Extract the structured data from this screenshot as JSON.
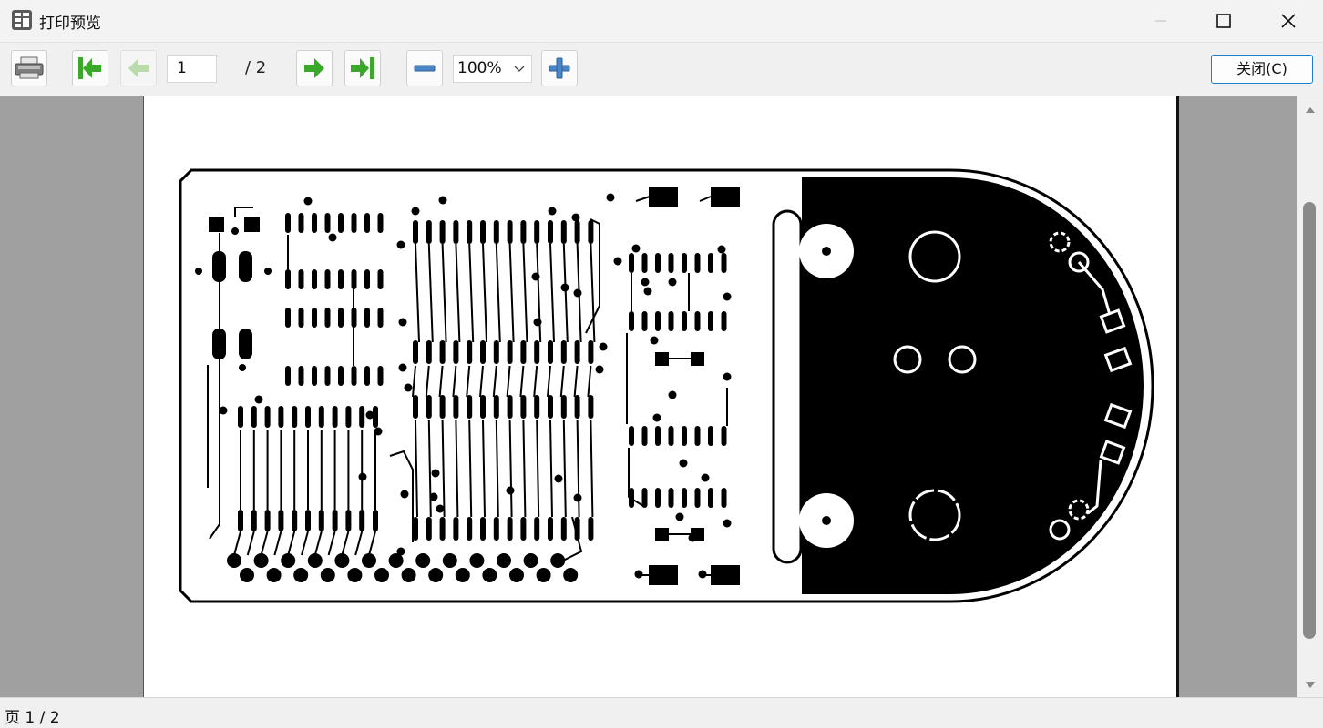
{
  "window": {
    "title": "打印预览",
    "app_icon": "document-grid-icon"
  },
  "toolbar": {
    "current_page": "1",
    "page_total": "/ 2",
    "zoom": "100%",
    "close_label": "关闭(C)",
    "icons": [
      "printer-icon",
      "first-page-icon",
      "previous-page-icon",
      "next-page-icon",
      "last-page-icon",
      "zoom-out-icon",
      "zoom-in-icon"
    ]
  },
  "status": {
    "text": "页 1 / 2"
  },
  "colors": {
    "accent": "#1f7ec9",
    "arrow_green": "#3ca82b"
  }
}
